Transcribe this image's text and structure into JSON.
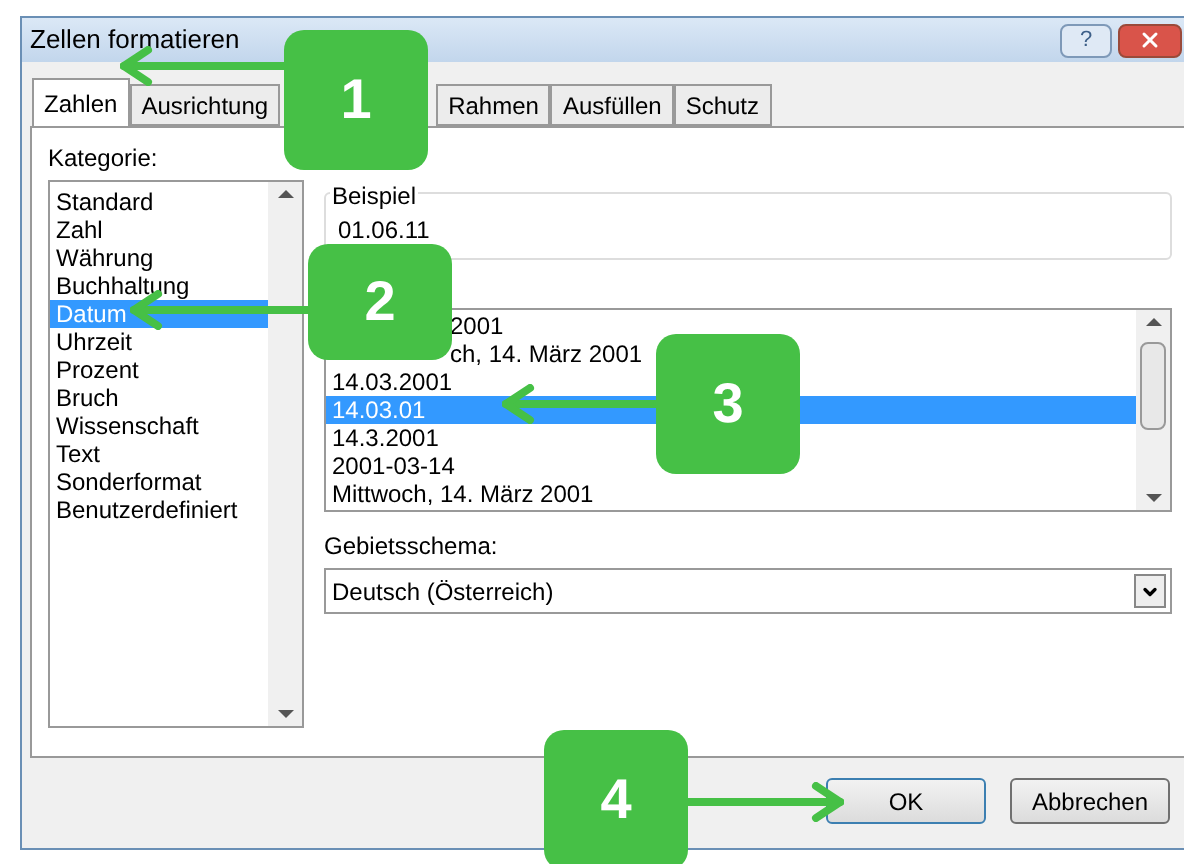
{
  "window": {
    "title": "Zellen formatieren",
    "help_button": "?"
  },
  "tabs": [
    {
      "label": "Zahlen",
      "selected": true
    },
    {
      "label": "Ausrichtung",
      "selected": false
    },
    {
      "label": "Rahmen",
      "selected": false
    },
    {
      "label": "Ausfüllen",
      "selected": false
    },
    {
      "label": "Schutz",
      "selected": false
    }
  ],
  "category": {
    "label": "Kategorie:",
    "items": [
      {
        "label": "Standard",
        "selected": false
      },
      {
        "label": "Zahl",
        "selected": false
      },
      {
        "label": "Währung",
        "selected": false
      },
      {
        "label": "Buchhaltung",
        "selected": false
      },
      {
        "label": "Datum",
        "selected": true
      },
      {
        "label": "Uhrzeit",
        "selected": false
      },
      {
        "label": "Prozent",
        "selected": false
      },
      {
        "label": "Bruch",
        "selected": false
      },
      {
        "label": "Wissenschaft",
        "selected": false
      },
      {
        "label": "Text",
        "selected": false
      },
      {
        "label": "Sonderformat",
        "selected": false
      },
      {
        "label": "Benutzerdefiniert",
        "selected": false
      }
    ]
  },
  "sample": {
    "label": "Beispiel",
    "value": "01.06.11"
  },
  "type_list": [
    {
      "label": "2001",
      "selected": false
    },
    {
      "label": "ch, 14. März 2001",
      "selected": false
    },
    {
      "label": "14.03.2001",
      "selected": false
    },
    {
      "label": "14.03.01",
      "selected": true
    },
    {
      "label": "14.3.2001",
      "selected": false
    },
    {
      "label": "2001-03-14",
      "selected": false
    },
    {
      "label": "Mittwoch, 14. März 2001",
      "selected": false
    }
  ],
  "locale": {
    "label": "Gebietsschema:",
    "value": "Deutsch (Österreich)"
  },
  "buttons": [
    {
      "label": "OK",
      "default": true
    },
    {
      "label": "Abbrechen",
      "default": false
    }
  ],
  "callouts": [
    {
      "label": "1"
    },
    {
      "label": "2"
    },
    {
      "label": "3"
    },
    {
      "label": "4"
    }
  ]
}
